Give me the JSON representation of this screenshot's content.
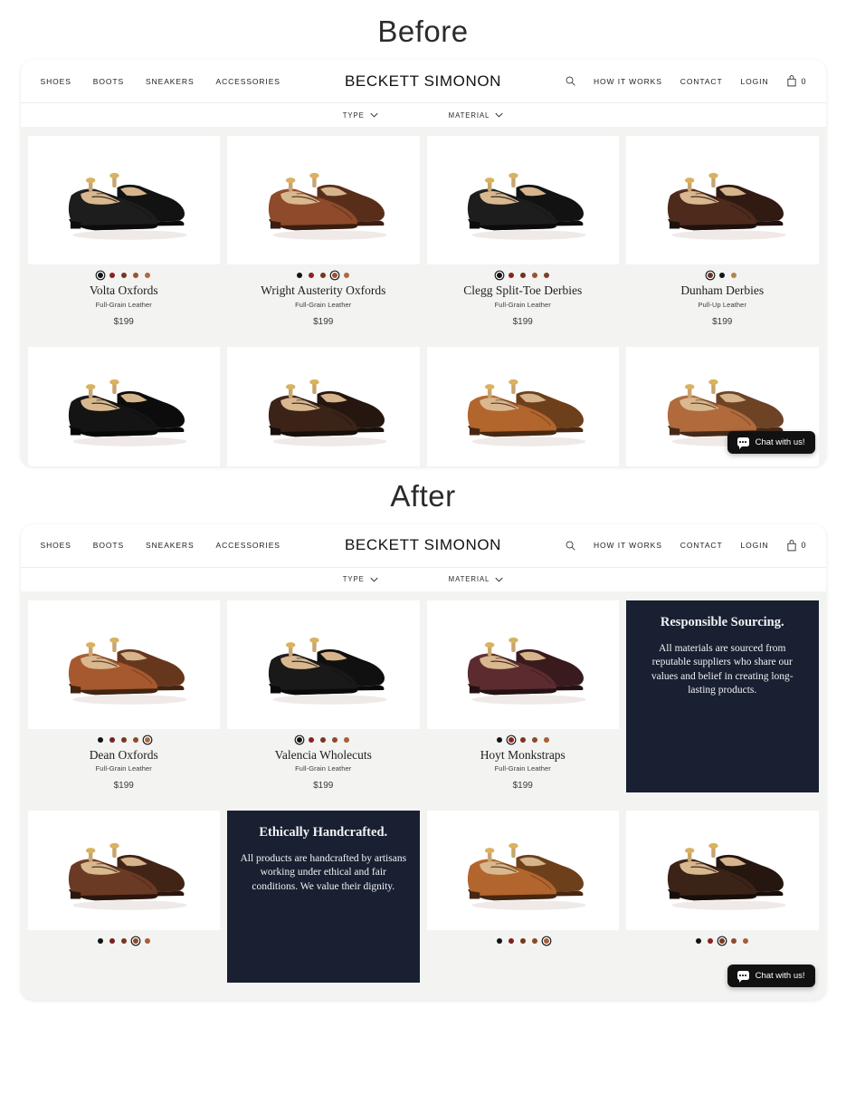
{
  "sections": {
    "before_label": "Before",
    "after_label": "After"
  },
  "site": {
    "brand": "BECKETT SIMONON",
    "nav_left": [
      {
        "label": "SHOES"
      },
      {
        "label": "BOOTS"
      },
      {
        "label": "SNEAKERS"
      },
      {
        "label": "ACCESSORIES"
      }
    ],
    "nav_right": [
      {
        "label": "HOW IT WORKS"
      },
      {
        "label": "CONTACT"
      },
      {
        "label": "LOGIN"
      }
    ],
    "search_icon": "search-icon",
    "cart_icon": "shopping-bag-icon",
    "cart_count": "0",
    "filters": [
      {
        "label": "TYPE"
      },
      {
        "label": "MATERIAL"
      }
    ]
  },
  "chat_widget": {
    "label": "Chat with us!",
    "icon": "chat-bubble-icon"
  },
  "before": {
    "row1": [
      {
        "name": "Volta Oxfords",
        "material": "Full-Grain Leather",
        "price": "$199",
        "shoe_color": "#1d1d1d",
        "swatches": [
          "#141414",
          "#8b2020",
          "#7a3520",
          "#9a5230",
          "#b06a3c"
        ],
        "selected": 0
      },
      {
        "name": "Wright Austerity Oxfords",
        "material": "Full-Grain Leather",
        "price": "$199",
        "shoe_color": "#8e4a2a",
        "swatches": [
          "#141414",
          "#8b2020",
          "#7a3520",
          "#9a5230",
          "#b06a3c"
        ],
        "selected": 3
      },
      {
        "name": "Clegg Split-Toe Derbies",
        "material": "Full-Grain Leather",
        "price": "$199",
        "shoe_color": "#1d1d1d",
        "swatches": [
          "#141414",
          "#8b2020",
          "#6d3320",
          "#9a5230",
          "#7d4028"
        ],
        "selected": 0
      },
      {
        "name": "Dunham Derbies",
        "material": "Pull-Up Leather",
        "price": "$199",
        "shoe_color": "#4e2a1c",
        "swatches": [
          "#6d3320",
          "#141414",
          "#b88246"
        ],
        "selected": 0
      }
    ],
    "row2": [
      {
        "shoe_color": "#141414"
      },
      {
        "shoe_color": "#3b2318"
      },
      {
        "shoe_color": "#b2652c"
      },
      {
        "shoe_color": "#b06a3c"
      }
    ]
  },
  "after": {
    "row1": [
      {
        "kind": "product",
        "name": "Dean Oxfords",
        "material": "Full-Grain Leather",
        "price": "$199",
        "shoe_color": "#a6592e",
        "swatches": [
          "#141414",
          "#7a2020",
          "#7a3520",
          "#8a4a2c",
          "#b06a3c"
        ],
        "selected": 4
      },
      {
        "kind": "product",
        "name": "Valencia Wholecuts",
        "material": "Full-Grain Leather",
        "price": "$199",
        "shoe_color": "#191919",
        "swatches": [
          "#141414",
          "#8b2020",
          "#7a3520",
          "#8a4a2c",
          "#a95f33"
        ],
        "selected": 0
      },
      {
        "kind": "product",
        "name": "Hoyt Monkstraps",
        "material": "Full-Grain Leather",
        "price": "$199",
        "shoe_color": "#5c2b30",
        "swatches": [
          "#141414",
          "#8b2020",
          "#7a3520",
          "#8a4a2c",
          "#a95f33"
        ],
        "selected": 1
      },
      {
        "kind": "promo",
        "title": "Responsible Sourcing.",
        "body": "All materials are sourced from reputable suppliers who share our values and belief in creating long-lasting products."
      }
    ],
    "row2": [
      {
        "kind": "product",
        "shoe_color": "#6b3a24",
        "swatches": [
          "#141414",
          "#7a2020",
          "#7a3520",
          "#8a4a2c",
          "#a95f33"
        ],
        "selected": 3
      },
      {
        "kind": "promo",
        "title": "Ethically Handcrafted.",
        "body": "All products are handcrafted by artisans working under ethical and fair conditions. We value their dignity."
      },
      {
        "kind": "product",
        "shoe_color": "#b2652c",
        "swatches": [
          "#141414",
          "#7a2020",
          "#7a3520",
          "#8a4a2c",
          "#a95f33"
        ],
        "selected": 4
      },
      {
        "kind": "product",
        "shoe_color": "#3b2318",
        "swatches": [
          "#141414",
          "#8b2020",
          "#7a3520",
          "#8a4a2c",
          "#a95f33"
        ],
        "selected": 2
      }
    ]
  },
  "colors": {
    "promo_bg": "#182032",
    "page_bg": "#ffffff",
    "grid_bg": "#f3f3f2",
    "card_bg": "#ffffff",
    "chat_bg": "#111111"
  }
}
